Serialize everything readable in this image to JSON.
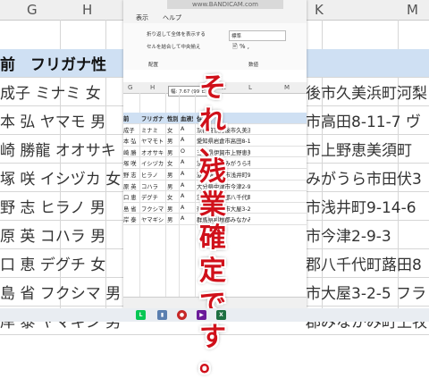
{
  "background": {
    "column_headers": [
      "G",
      "H",
      "I",
      "J",
      "K",
      "L",
      "M"
    ],
    "rows": [
      {
        "left": "前　フリガナ性",
        "right": ""
      },
      {
        "left": "成子 ミナミ 女",
        "right": "後市久美浜町河梨"
      },
      {
        "left": "本 弘 ヤマモ 男",
        "right": "市高田8-11-7 ヴ"
      },
      {
        "left": "崎 勝龍 オオサキ 男",
        "right": "市上野恵美須町"
      },
      {
        "left": "塚 咲 イシヅカ 女",
        "right": "みがうら市田伏3"
      },
      {
        "left": "野 志 ヒラノ 男",
        "right": "市浅井町9-14-6"
      },
      {
        "left": "原 英 コハラ 男",
        "right": "市今津2-9-3"
      },
      {
        "left": "口 恵 デグチ 女",
        "right": "郡八千代町蕗田8"
      },
      {
        "left": "島 省 フクシマ 男",
        "right": "市大屋3-2-5 フラ"
      },
      {
        "left": "岸 泰 ヤマギシ 男",
        "right": "郡みなかみ町上牧"
      }
    ]
  },
  "app": {
    "watermark": "www.BANDICAM.com",
    "menu": [
      "表示",
      "ヘルプ"
    ],
    "ribbon": {
      "wrap_text": "折り返して全体を表示する",
      "merge_center": "セルを結合して中央揃え",
      "number_format": "標準",
      "group_alignment": "配置",
      "group_number": "数値"
    },
    "tooltip": "幅: 7.67 (99 ピ",
    "column_headers": [
      "G",
      "H",
      "I",
      "J",
      "K",
      "L",
      "M"
    ],
    "table_header": {
      "name": "前",
      "kana": "フリガナ",
      "gender": "性別",
      "blood": "血液型",
      "address": "住所"
    },
    "rows": [
      {
        "name": "成子",
        "kana": "ミナミ",
        "gender": "女",
        "blood": "A",
        "address": "京都府京丹後市久美浜町河梨"
      },
      {
        "name": "本 弘",
        "kana": "ヤマモト",
        "gender": "男",
        "blood": "A",
        "address": "愛知県岩倉市高田8-11-7 ヴ"
      },
      {
        "name": "崎 勝",
        "kana": "オオサキ",
        "gender": "男",
        "blood": "O",
        "address": "三重県伊賀市上野恵美須町"
      },
      {
        "name": "塚 咲",
        "kana": "イシヅカ",
        "gender": "女",
        "blood": "A",
        "address": "茨城県かすみがうら市田伏3"
      },
      {
        "name": "野 志",
        "kana": "ヒラノ",
        "gender": "男",
        "blood": "A",
        "address": "滋賀県長浜市浅井町9-14-6"
      },
      {
        "name": "原 英",
        "kana": "コハラ",
        "gender": "男",
        "blood": "A",
        "address": "大分県中津市今津2-9-3"
      },
      {
        "name": "口 恵",
        "kana": "デグチ",
        "gender": "女",
        "blood": "A",
        "address": "茨城県結城郡八千代町蕗田8"
      },
      {
        "name": "島 省",
        "kana": "フクシマ",
        "gender": "男",
        "blood": "A",
        "address": "奈良県葛城市大屋3-2-5 フラ"
      },
      {
        "name": "岸 泰",
        "kana": "ヤマギシ",
        "gender": "男",
        "blood": "A",
        "address": "群馬県利根郡みなかみ町上牧"
      }
    ]
  },
  "caption": {
    "chars": [
      "そ",
      "れ",
      "、",
      "残",
      "業",
      "確",
      "定",
      "で",
      "す",
      "。"
    ],
    "color": "#d0101a"
  },
  "taskbar": {
    "icons": [
      "line-icon",
      "phone-icon",
      "record-icon",
      "video-icon",
      "excel-icon"
    ]
  }
}
